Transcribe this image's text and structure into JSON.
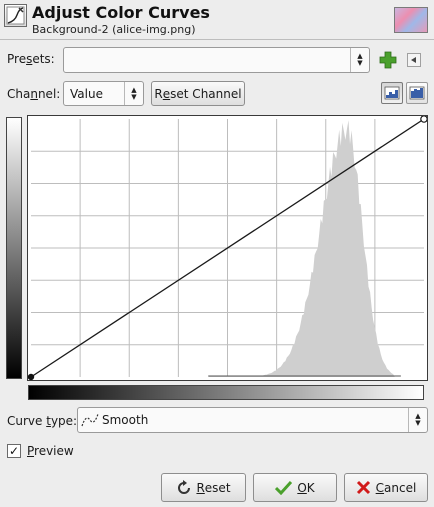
{
  "header": {
    "title": "Adjust Color Curves",
    "subtitle": "Background-2 (alice-img.png)",
    "dialog_icon": "curves-tool-icon",
    "thumbnail": "image-thumbnail"
  },
  "presets": {
    "label_pre": "Pre",
    "label_key": "s",
    "label_post": "ets:",
    "value": "",
    "add_icon": "plus-icon",
    "menu_icon": "triangle-left-icon"
  },
  "channel": {
    "label_pre": "Cha",
    "label_key": "n",
    "label_post": "nel:",
    "value": "Value",
    "reset_label_pre": "R",
    "reset_label_key": "e",
    "reset_label_post": "set Channel",
    "linear_icon": "linear-histogram-icon",
    "log_icon": "log-histogram-icon",
    "scale_selected": "linear"
  },
  "curve": {
    "type_label_pre": "Curve ",
    "type_label_key": "t",
    "type_label_post": "ype:",
    "type_value": "Smooth",
    "type_icon": "smooth-curve-icon",
    "points": [
      [
        0,
        0
      ],
      [
        255,
        255
      ]
    ]
  },
  "preview": {
    "label_key": "P",
    "label_rest": "review",
    "checked": true
  },
  "buttons": {
    "reset_key": "R",
    "reset_rest": "eset",
    "reset_icon": "reset-icon",
    "ok_key": "O",
    "ok_rest": "K",
    "ok_icon": "checkmark-icon",
    "cancel_key": "C",
    "cancel_rest": "ancel",
    "cancel_icon": "cancel-x-icon"
  },
  "colors": {
    "accent_green": "#4aa02c",
    "cancel_red": "#d11a1a",
    "histogram": "#cfcfcf"
  }
}
